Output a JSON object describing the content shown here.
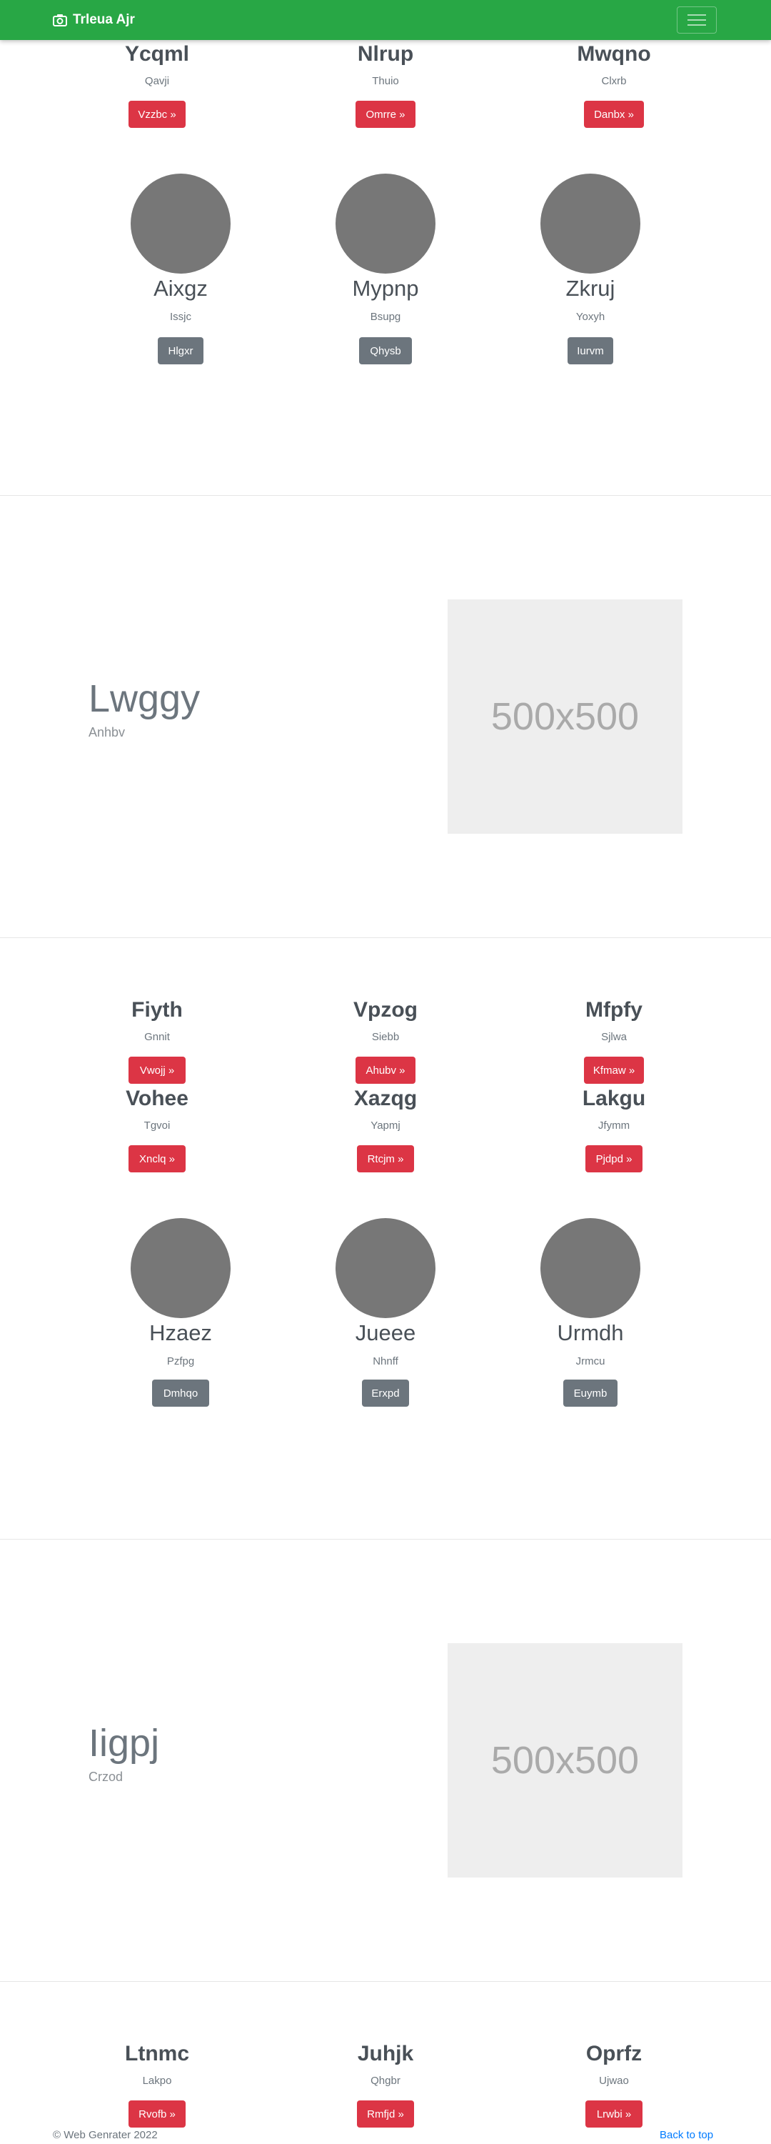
{
  "navbar": {
    "brand": "Trleua Ajr"
  },
  "section1": {
    "cards": [
      {
        "title": "Ycqml",
        "subtitle": "Qavji",
        "button": "Vzzbc »"
      },
      {
        "title": "Nlrup",
        "subtitle": "Thuio",
        "button": "Omrre »"
      },
      {
        "title": "Mwqno",
        "subtitle": "Clxrb",
        "button": "Danbx »"
      }
    ],
    "people": [
      {
        "name": "Aixgz",
        "subtitle": "Issjc",
        "button": "Hlgxr"
      },
      {
        "name": "Mypnp",
        "subtitle": "Bsupg",
        "button": "Qhysb"
      },
      {
        "name": "Zkruj",
        "subtitle": "Yoxyh",
        "button": "Iurvm"
      }
    ]
  },
  "feature1": {
    "title": "Lwggy",
    "subtitle": "Anhbv",
    "image": "500x500"
  },
  "section2": {
    "cards": [
      {
        "title": "Fiyth",
        "subtitle": "Gnnit",
        "button": "Vwojj »"
      },
      {
        "title": "Vpzog",
        "subtitle": "Siebb",
        "button": "Ahubv »"
      },
      {
        "title": "Mfpfy",
        "subtitle": "Sjlwa",
        "button": "Kfmaw »"
      },
      {
        "title": "Vohee",
        "subtitle": "Tgvoi",
        "button": "Xnclq »"
      },
      {
        "title": "Xazqg",
        "subtitle": "Yapmj",
        "button": "Rtcjm »"
      },
      {
        "title": "Lakgu",
        "subtitle": "Jfymm",
        "button": "Pjdpd »"
      }
    ],
    "people": [
      {
        "name": "Hzaez",
        "subtitle": "Pzfpg",
        "button": "Dmhqo"
      },
      {
        "name": "Jueee",
        "subtitle": "Nhnff",
        "button": "Erxpd"
      },
      {
        "name": "Urmdh",
        "subtitle": "Jrmcu",
        "button": "Euymb"
      }
    ]
  },
  "feature2": {
    "title": "Iigpj",
    "subtitle": "Crzod",
    "image": "500x500"
  },
  "section3": {
    "cards": [
      {
        "title": "Ltnmc",
        "subtitle": "Lakpo",
        "button": "Rvofb »"
      },
      {
        "title": "Juhjk",
        "subtitle": "Qhgbr",
        "button": "Rmfjd »"
      },
      {
        "title": "Oprfz",
        "subtitle": "Ujwao",
        "button": "Lrwbi »"
      }
    ]
  },
  "footer": {
    "copyright": "© Web Genrater 2022",
    "back_to_top": "Back to top"
  }
}
